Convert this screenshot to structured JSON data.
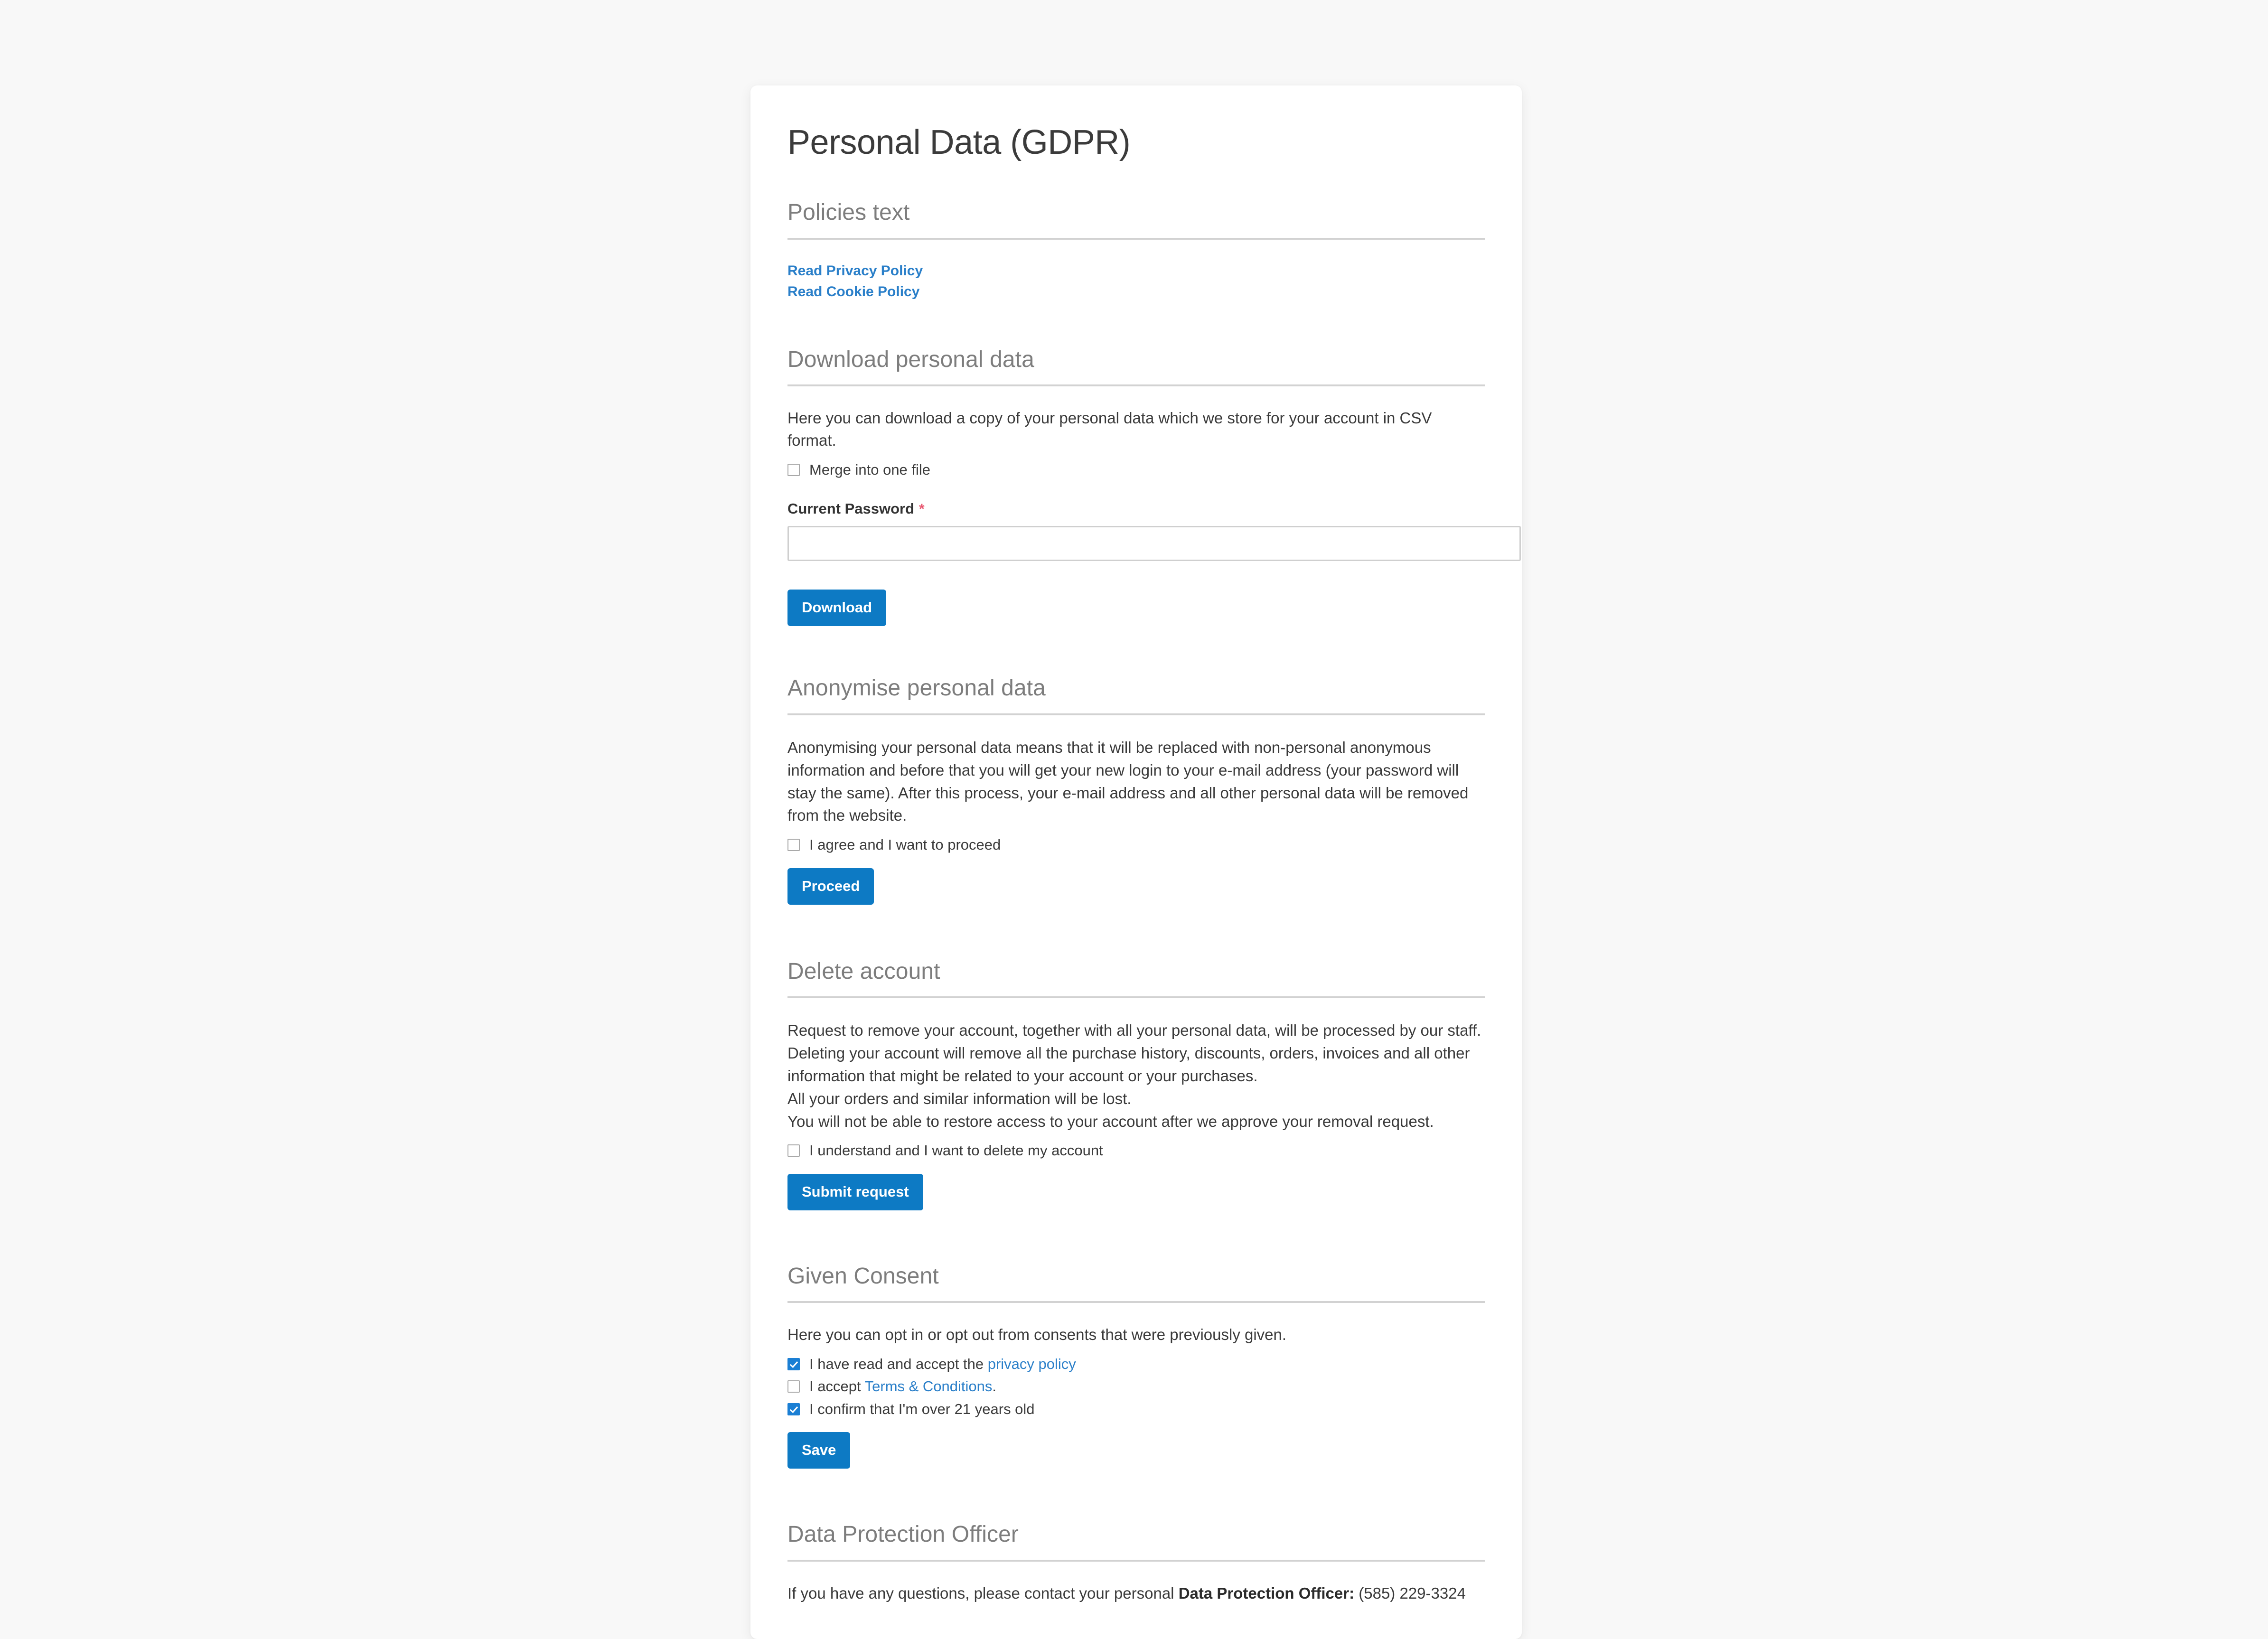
{
  "page": {
    "title": "Personal Data (GDPR)",
    "background_color": "#f8f8f8",
    "card_background": "#ffffff",
    "accent_color": "#0d7ac4",
    "link_color": "#2a7fc9",
    "required_color": "#e8566f"
  },
  "policies": {
    "heading": "Policies text",
    "links": [
      {
        "label": "Read Privacy Policy"
      },
      {
        "label": "Read Cookie Policy"
      }
    ]
  },
  "download": {
    "heading": "Download personal data",
    "description": "Here you can download a copy of your personal data which we store for your account in CSV format.",
    "merge_checkbox": {
      "label": "Merge into one file",
      "checked": false
    },
    "password_label": "Current Password",
    "required_marker": "*",
    "password_value": "",
    "password_placeholder": "",
    "button_label": "Download"
  },
  "anonymise": {
    "heading": "Anonymise personal data",
    "description": "Anonymising your personal data means that it will be replaced with non-personal anonymous information and before that you will get your new login to your e-mail address (your password will stay the same). After this process, your e-mail address and all other personal data will be removed from the website.",
    "agree_checkbox": {
      "label": "I agree and I want to proceed",
      "checked": false
    },
    "button_label": "Proceed"
  },
  "delete": {
    "heading": "Delete account",
    "paragraphs": [
      "Request to remove your account, together with all your personal data, will be processed by our staff.",
      "Deleting your account will remove all the purchase history, discounts, orders, invoices and all other information that might be related to your account or your purchases.",
      "All your orders and similar information will be lost.",
      "You will not be able to restore access to your account after we approve your removal request."
    ],
    "understand_checkbox": {
      "label": "I understand and I want to delete my account",
      "checked": false
    },
    "button_label": "Submit request"
  },
  "consent": {
    "heading": "Given Consent",
    "description": "Here you can opt in or opt out from consents that were previously given.",
    "items": [
      {
        "text_before": "I have read and accept the ",
        "link_text": "privacy policy",
        "text_after": "",
        "checked": true
      },
      {
        "text_before": "I accept ",
        "link_text": "Terms & Conditions",
        "text_after": ".",
        "checked": false
      },
      {
        "text_before": "I confirm that I'm over 21 years old",
        "link_text": "",
        "text_after": "",
        "checked": true
      }
    ],
    "button_label": "Save"
  },
  "dpo": {
    "heading": "Data Protection Officer",
    "text_before": "If you have any questions, please contact your personal ",
    "label": "Data Protection Officer:",
    "phone": " (585) 229-3324"
  }
}
